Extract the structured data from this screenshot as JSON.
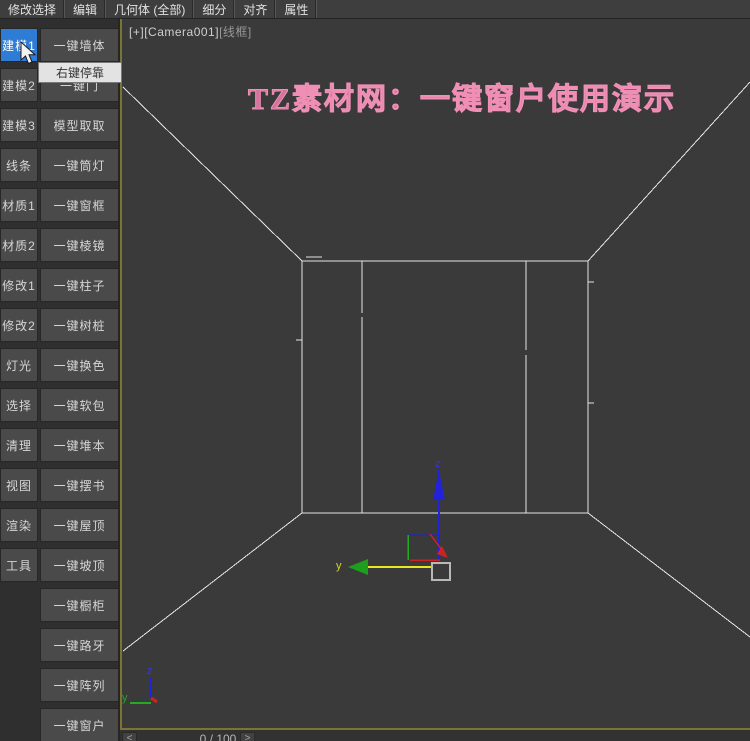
{
  "menu": {
    "items": [
      "修改选择",
      "编辑",
      "几何体 (全部)",
      "细分",
      "对齐",
      "属性"
    ]
  },
  "sidebar": {
    "left_items": [
      {
        "label": "建模1",
        "selected": true
      },
      {
        "label": "建模2",
        "selected": false
      },
      {
        "label": "建模3",
        "selected": false
      },
      {
        "label": "线条",
        "selected": false
      },
      {
        "label": "材质1",
        "selected": false
      },
      {
        "label": "材质2",
        "selected": false
      },
      {
        "label": "修改1",
        "selected": false
      },
      {
        "label": "修改2",
        "selected": false
      },
      {
        "label": "灯光",
        "selected": false
      },
      {
        "label": "选择",
        "selected": false
      },
      {
        "label": "清理",
        "selected": false
      },
      {
        "label": "视图",
        "selected": false
      },
      {
        "label": "渲染",
        "selected": false
      },
      {
        "label": "工具",
        "selected": false
      }
    ],
    "right_items": [
      "一键墙体",
      "一键门",
      "模型取取",
      "一键筒灯",
      "一键窗框",
      "一键棱镜",
      "一键柱子",
      "一键树桩",
      "一键换色",
      "一键软包",
      "一键堆本",
      "一键摆书",
      "一键屋顶",
      "一键坡顶",
      "一键橱柜",
      "一键路牙",
      "一键阵列",
      "一键窗户"
    ],
    "tooltip": "右键停靠"
  },
  "viewport": {
    "label_plus": "[+]",
    "label_camera": "[Camera001]",
    "label_shading": "[线框]",
    "title": "TZ素材网：一键窗户使用演示",
    "gizmo": {
      "z_label": "z",
      "y_label": "y"
    },
    "world_axis": {
      "z_label": "z",
      "y_label": "y"
    }
  },
  "timebar": {
    "prev": "<",
    "frame": "0 / 100",
    "next": ">"
  },
  "colors": {
    "selected_button": "#2e7cd6",
    "viewport_border": "#7d7433",
    "wireframe": "#e4e4e4",
    "title_pink": "#e886ae",
    "axis_x_red": "#cc2222",
    "axis_y_green": "#22aa22",
    "axis_z_blue": "#2222dd",
    "axis_locked_yellow": "#e8e822"
  }
}
